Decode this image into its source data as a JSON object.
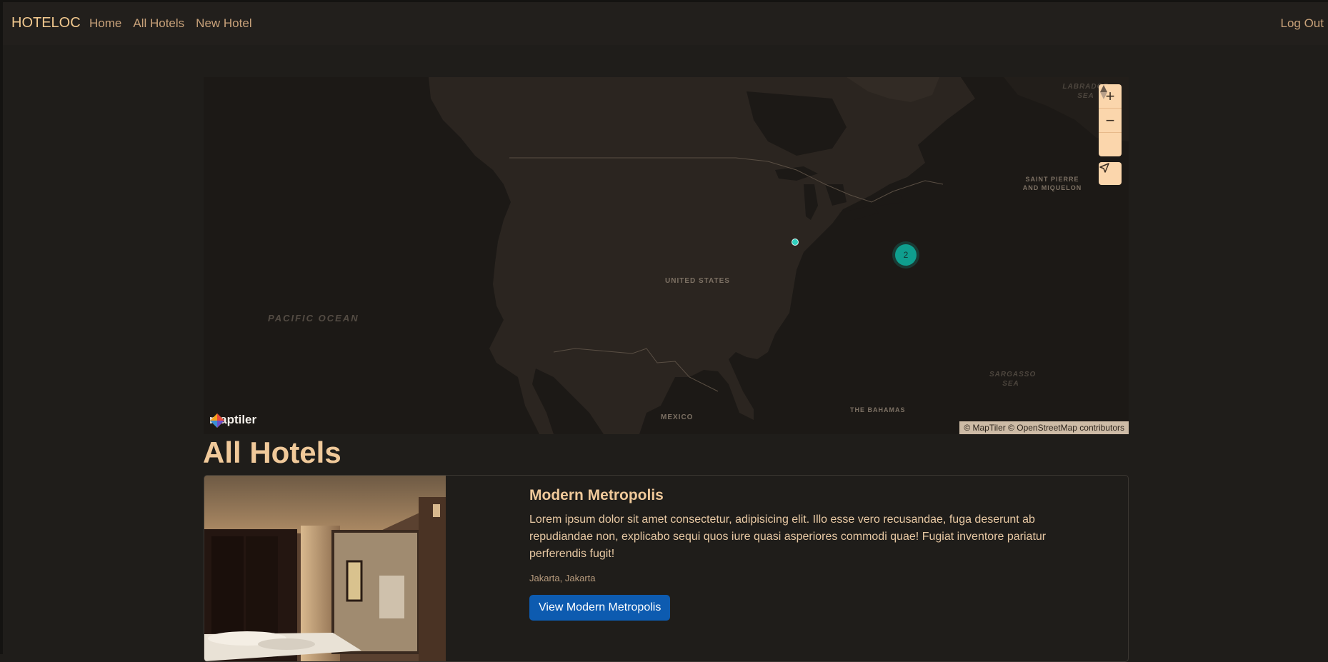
{
  "navbar": {
    "brand": "HOTELOC",
    "links": [
      "Home",
      "All Hotels",
      "New Hotel"
    ],
    "logout": "Log Out"
  },
  "map": {
    "labels": {
      "pacific_ocean": "PACIFIC OCEAN",
      "united_states": "UNITED STATES",
      "mexico": "MEXICO",
      "the_bahamas": "THE BAHAMAS",
      "sargasso_sea": "SARGASSO SEA",
      "labrador_sea": "LABRADOR SEA",
      "saint_pierre": "SAINT PIERRE AND MIQUELON"
    },
    "controls": {
      "zoom_in": "+",
      "zoom_out": "−"
    },
    "cluster_count": "2",
    "logo_text": "maptiler",
    "attribution": "© MapTiler © OpenStreetMap contributors",
    "colors": {
      "land": "#2b2520",
      "water": "#1c1916",
      "cluster": "#0f9e8e",
      "control": "#fbd6ac"
    }
  },
  "page": {
    "heading": "All Hotels"
  },
  "hotels": [
    {
      "title": "Modern Metropolis",
      "description": "Lorem ipsum dolor sit amet consectetur, adipisicing elit. Illo esse vero recusandae, fuga deserunt ab repudiandae non, explicabo sequi quos iure quasi asperiores commodi quae! Fugiat inventore pariatur perferendis fugit!",
      "location": "Jakarta, Jakarta",
      "button": "View Modern Metropolis"
    }
  ]
}
